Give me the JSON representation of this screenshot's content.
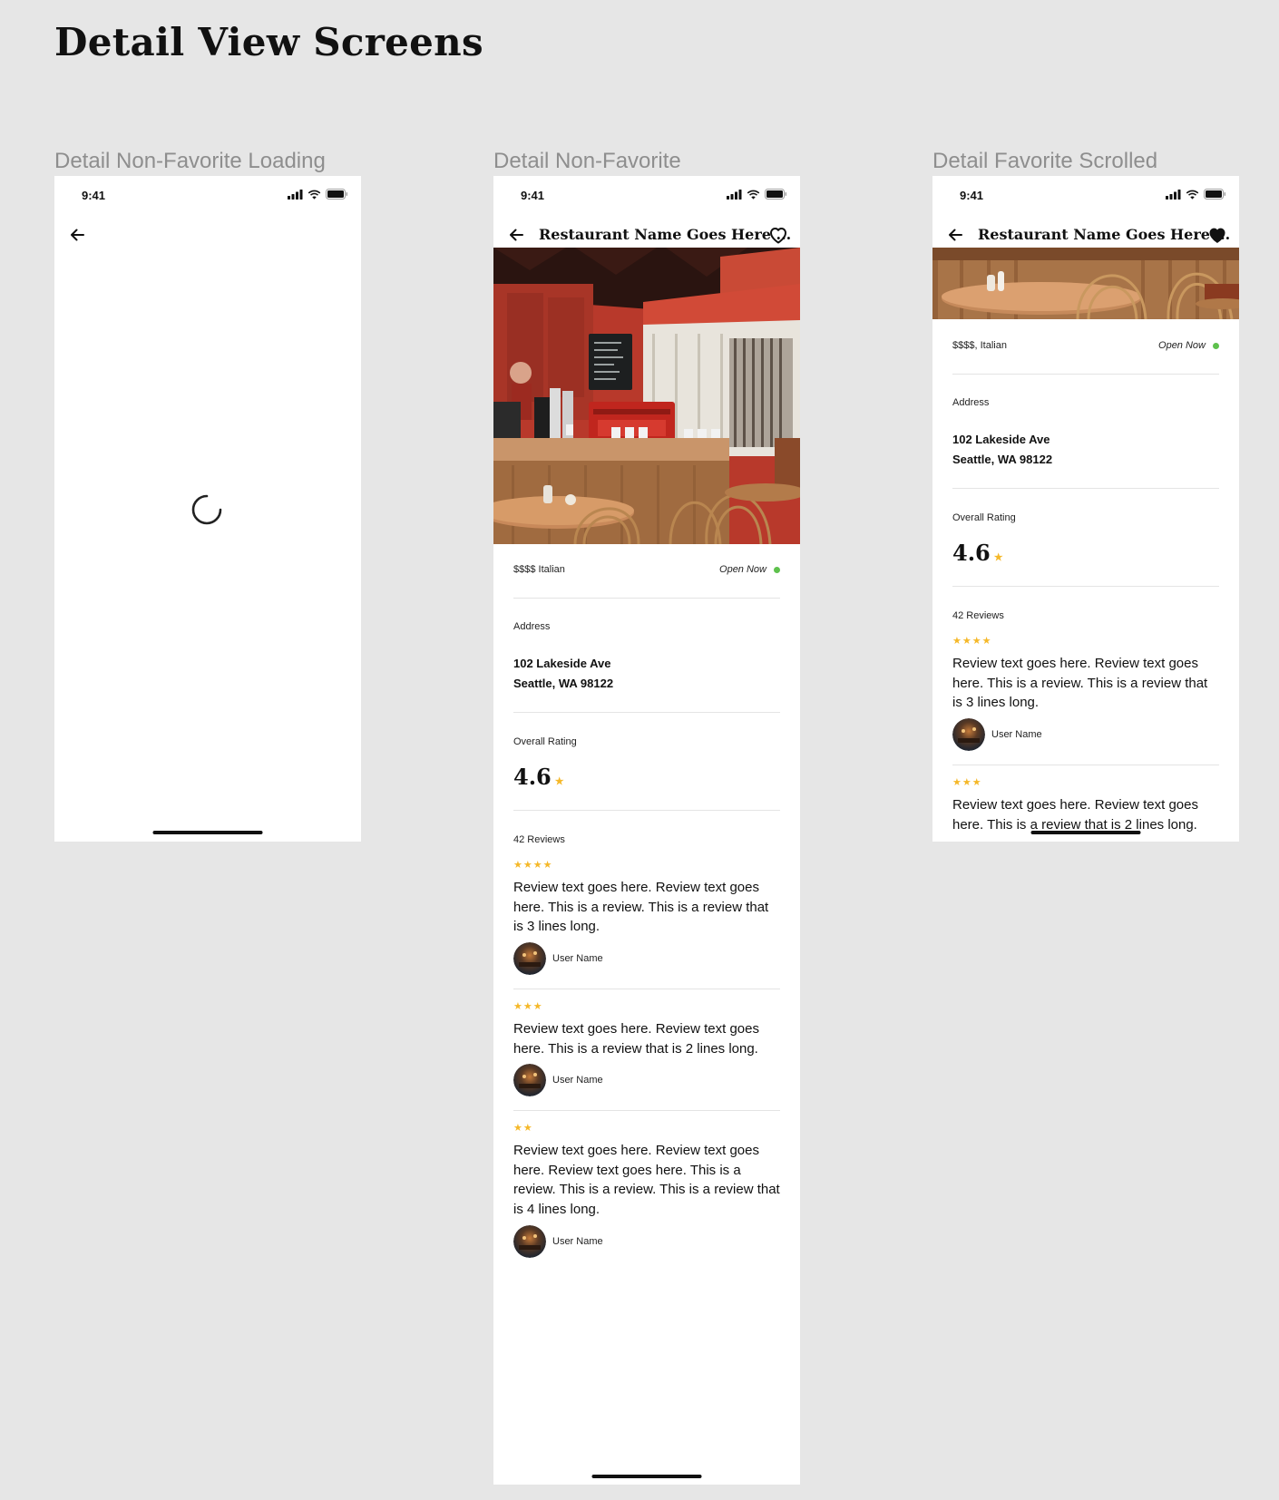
{
  "page_title": "Detail View Screens",
  "colors": {
    "background": "#e6e6e6",
    "star": "#f5b829",
    "open_dot": "#5ec14d",
    "text": "#111111"
  },
  "icons": {
    "back": "arrow-left-icon",
    "favorite_outline": "heart-outline-icon",
    "favorite_filled": "heart-filled-icon",
    "spinner": "loading-spinner-icon",
    "signal": "cellular-signal-icon",
    "wifi": "wifi-icon",
    "battery": "battery-icon",
    "star": "star-icon"
  },
  "frames": {
    "loading": {
      "label": "Detail Non-Favorite Loading",
      "status_time": "9:41"
    },
    "non_favorite": {
      "label": "Detail Non-Favorite",
      "status_time": "9:41",
      "title": "Restaurant Name Goes Here ...",
      "favorited": false,
      "price_category": "$$$$ Italian",
      "open_status": "Open Now",
      "address_label": "Address",
      "address_line1": "102 Lakeside Ave",
      "address_line2": "Seattle, WA 98122",
      "rating_label": "Overall Rating",
      "rating_value": "4.6",
      "rating_star": "★",
      "reviews_count": "42 Reviews",
      "reviews": [
        {
          "stars": "★★★★",
          "rating": 4,
          "text": "Review text goes here. Review text goes here. This is a review. This is a review that is 3 lines long.",
          "user": "User Name"
        },
        {
          "stars": "★★★",
          "rating": 3,
          "text": "Review text goes here. Review text goes here. This is a review that is 2 lines long.",
          "user": "User Name"
        },
        {
          "stars": "★★",
          "rating": 2,
          "text": "Review text goes here. Review text goes here. Review text goes here. This is a review. This is a review. This is a review that is 4 lines long.",
          "user": "User Name"
        }
      ]
    },
    "favorite_scrolled": {
      "label": "Detail Favorite Scrolled",
      "status_time": "9:41",
      "title": "Restaurant Name Goes Here ...",
      "favorited": true,
      "price_category": "$$$$, Italian",
      "open_status": "Open Now",
      "address_label": "Address",
      "address_line1": "102 Lakeside Ave",
      "address_line2": "Seattle, WA 98122",
      "rating_label": "Overall Rating",
      "rating_value": "4.6",
      "rating_star": "★",
      "reviews_count": "42 Reviews",
      "reviews": [
        {
          "stars": "★★★★",
          "rating": 4,
          "text": "Review text goes here. Review text goes here. This is a review. This is a review that is 3 lines long.",
          "user": "User Name"
        },
        {
          "stars": "★★★",
          "rating": 3,
          "text": "Review text goes here. Review text goes here. This is a review that is 2 lines long.",
          "user": "User Name"
        }
      ]
    }
  }
}
